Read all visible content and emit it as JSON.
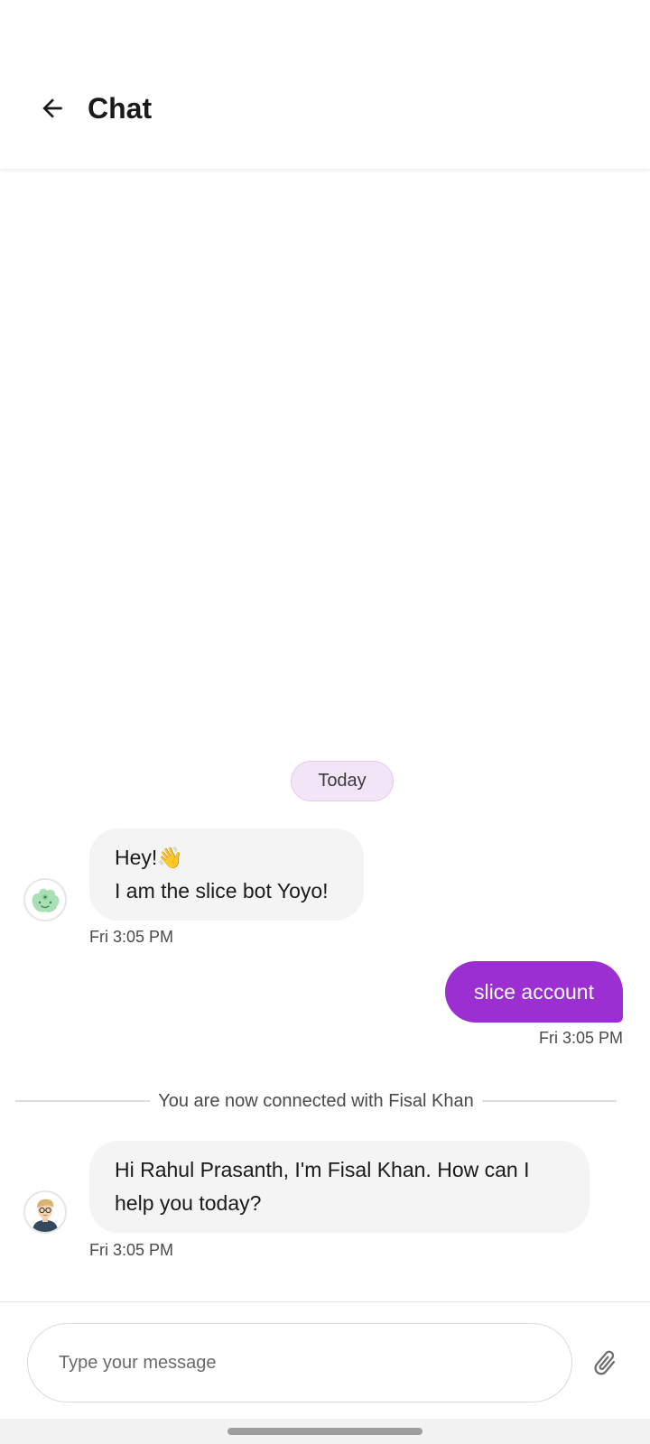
{
  "header": {
    "title": "Chat",
    "back_icon": "arrow-left-icon"
  },
  "date_chip": "Today",
  "messages": [
    {
      "sender": "bot",
      "avatar": "bot-avatar-icon",
      "line1": "Hey!",
      "emoji": "👋",
      "line2": "I am the slice bot Yoyo!",
      "time": "Fri 3:05 PM"
    },
    {
      "sender": "user",
      "text": "slice account",
      "time": "Fri 3:05 PM"
    },
    {
      "sender": "agent",
      "avatar": "agent-avatar-icon",
      "text": "Hi Rahul Prasanth, I'm Fisal Khan. How can I help you today?",
      "time": "Fri 3:05 PM"
    }
  ],
  "separator": "You are now connected with Fisal Khan",
  "composer": {
    "placeholder": "Type your message",
    "attach_icon": "paperclip-icon"
  },
  "colors": {
    "accent": "#9b2fd1",
    "chip_bg": "#f3e5f8",
    "bubble_in": "#f4f4f4"
  }
}
